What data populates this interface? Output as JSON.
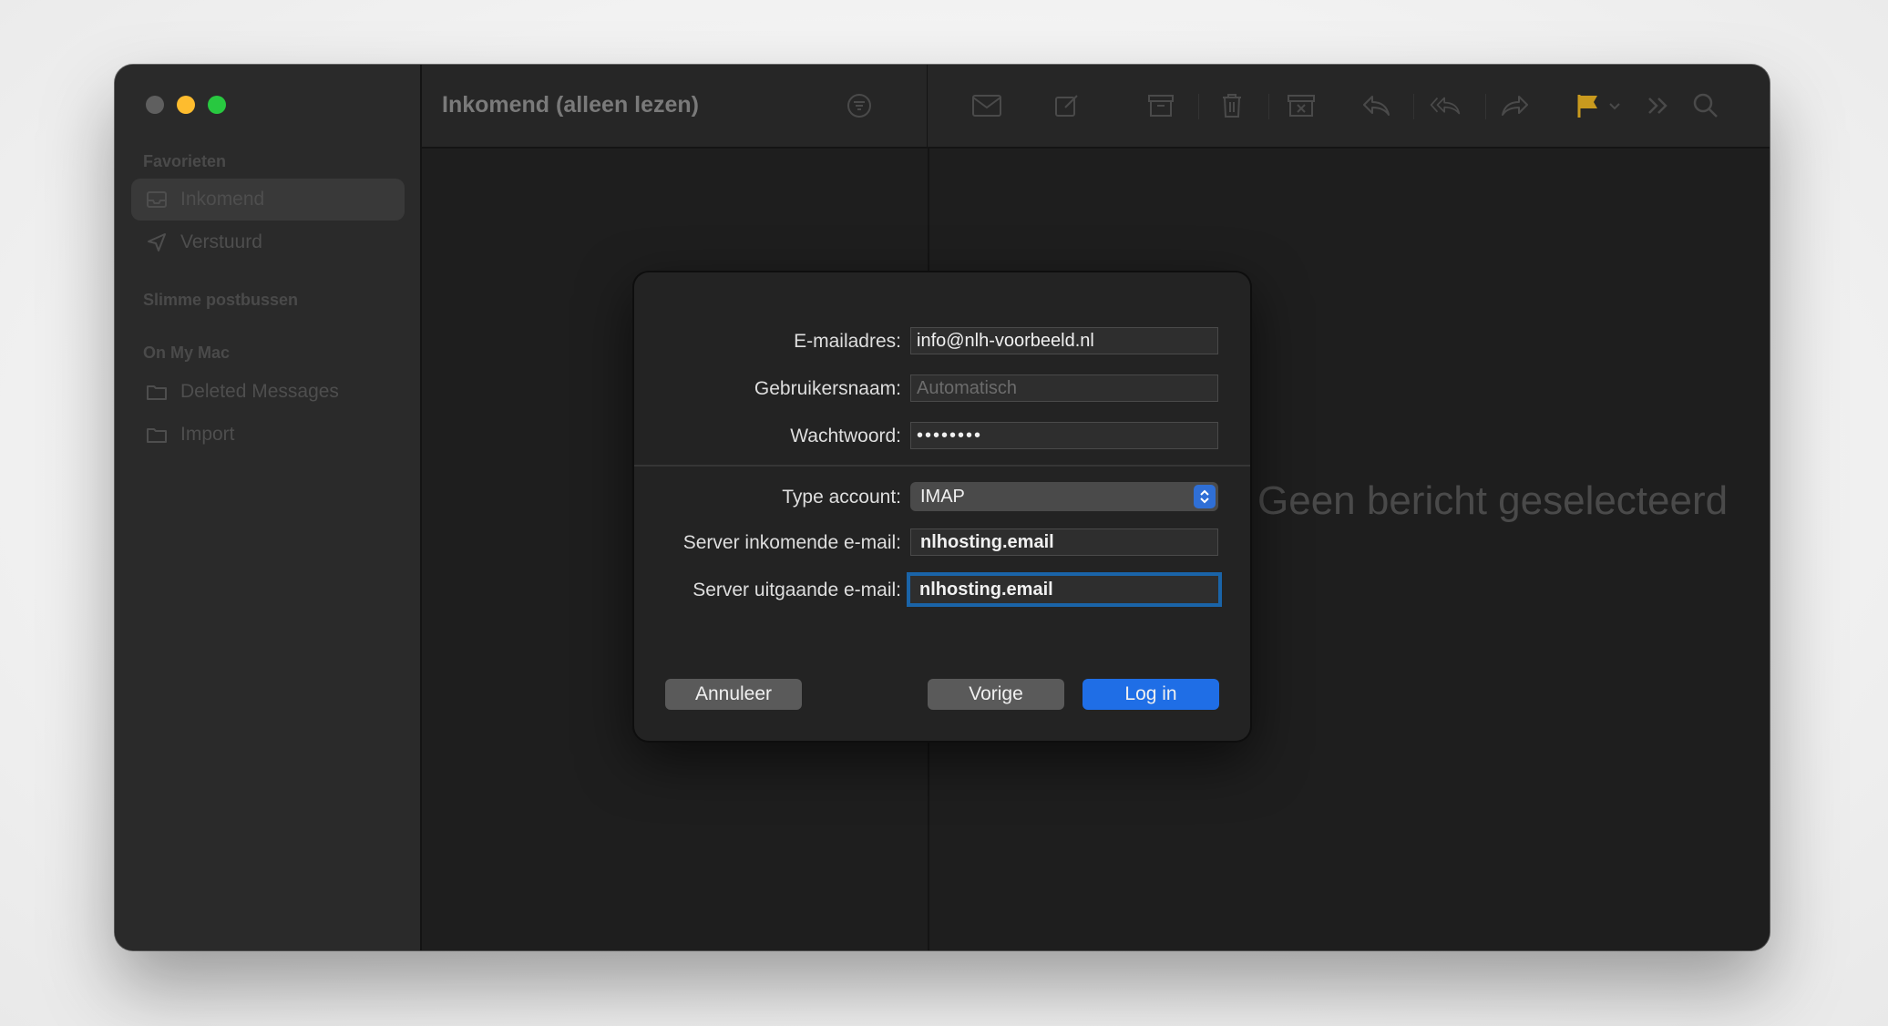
{
  "window": {
    "title": "Inkomend (alleen lezen)"
  },
  "sidebar": {
    "sections": [
      {
        "label": "Favorieten"
      },
      {
        "label": "Slimme postbussen"
      },
      {
        "label": "On My Mac"
      }
    ],
    "items": [
      {
        "label": "Inkomend",
        "icon": "inbox-icon",
        "selected": true
      },
      {
        "label": "Verstuurd",
        "icon": "paper-plane-icon",
        "selected": false
      },
      {
        "label": "Deleted Messages",
        "icon": "folder-icon",
        "selected": false
      },
      {
        "label": "Import",
        "icon": "folder-icon",
        "selected": false
      }
    ]
  },
  "toolbar": {
    "icons": [
      "filter-icon",
      "envelope-icon",
      "compose-icon",
      "archive-icon",
      "trash-icon",
      "junk-icon",
      "reply-icon",
      "reply-all-icon",
      "forward-icon",
      "flag-icon",
      "chevron-down-icon",
      "more-icon",
      "search-icon"
    ],
    "flag_color": "#c99a1e"
  },
  "message_pane": {
    "empty_text": "Geen bericht geselecteerd"
  },
  "dialog": {
    "fields": {
      "email_label": "E-mailadres:",
      "email_value": "info@nlh-voorbeeld.nl",
      "username_label": "Gebruikersnaam:",
      "username_placeholder": "Automatisch",
      "password_label": "Wachtwoord:",
      "password_value": "••••••••",
      "account_type_label": "Type account:",
      "account_type_value": "IMAP",
      "incoming_label": "Server inkomende e-mail:",
      "incoming_value": "nlhosting.email",
      "outgoing_label": "Server uitgaande e-mail:",
      "outgoing_value": "nlhosting.email"
    },
    "buttons": {
      "cancel": "Annuleer",
      "previous": "Vorige",
      "login": "Log in"
    },
    "accent_color": "#1f6ee6"
  }
}
